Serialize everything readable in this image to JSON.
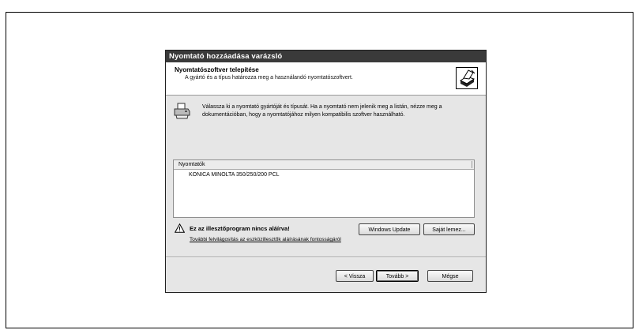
{
  "dialog": {
    "title": "Nyomtató hozzáadása varázsló",
    "header_title": "Nyomtatószoftver telepítése",
    "header_subtitle": "A gyártó és a típus határozza meg a használandó nyomtatószoftvert.",
    "header_icon": "printer-wizard-icon"
  },
  "info": {
    "icon": "printer-icon",
    "text": "Válassza ki a nyomtató gyártóját és típusát. Ha a nyomtató nem jelenik meg a listán, nézze meg a dokumentációban, hogy a nyomtatójához milyen kompatibilis szoftver használható."
  },
  "printer_list": {
    "header": "Nyomtatók",
    "items": [
      "KONICA MINOLTA 350/250/200 PCL"
    ]
  },
  "warning": {
    "icon": "warning-icon",
    "text": "Ez az illesztőprogram nincs aláírva!",
    "link": "További felvilágosítás az eszközillesztők aláírásának fontosságáról"
  },
  "buttons": {
    "windows_update": "Windows Update",
    "have_disk": "Saját lemez...",
    "back": "< Vissza",
    "next": "Tovább >",
    "cancel": "Mégse"
  }
}
